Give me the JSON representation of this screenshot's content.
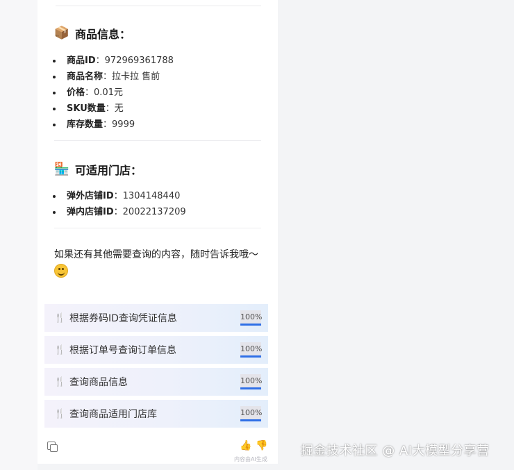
{
  "product_section": {
    "emoji": "📦",
    "title": "商品信息：",
    "items": [
      {
        "label": "商品ID",
        "value": "972969361788"
      },
      {
        "label": "商品名称",
        "value": "拉卡拉 售前"
      },
      {
        "label": "价格",
        "value": "0.01元"
      },
      {
        "label": "SKU数量",
        "value": "无"
      },
      {
        "label": "库存数量",
        "value": "9999"
      }
    ]
  },
  "store_section": {
    "emoji": "🏪",
    "title": "可适用门店：",
    "items": [
      {
        "label": "弹外店铺ID",
        "value": "1304148440"
      },
      {
        "label": "弹内店铺ID",
        "value": "20022137209"
      }
    ]
  },
  "closing_text": "如果还有其他需要查询的内容，随时告诉我哦～",
  "tools": [
    {
      "icon": "fork-knife-icon",
      "label": "根据券码ID查询凭证信息",
      "progress": "100%"
    },
    {
      "icon": "fork-knife-icon",
      "label": "根据订单号查询订单信息",
      "progress": "100%"
    },
    {
      "icon": "fork-knife-icon",
      "label": "查询商品信息",
      "progress": "100%"
    },
    {
      "icon": "fork-knife-icon",
      "label": "查询商品适用门店库",
      "progress": "100%"
    }
  ],
  "footer": {
    "ai_note": "内容由AI生成"
  },
  "watermark": "掘金技术社区 @ AI大模型分享营",
  "colors": {
    "progress_bar": "#2f6fe6",
    "tool_bg": "#eef1fb"
  }
}
